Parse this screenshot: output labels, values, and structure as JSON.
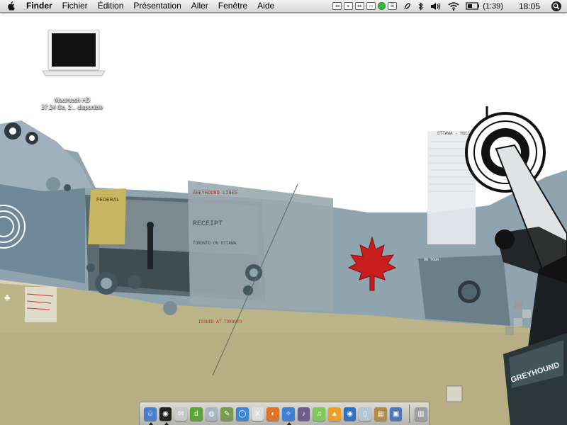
{
  "menubar": {
    "app_name": "Finder",
    "menus": [
      "Fichier",
      "Édition",
      "Présentation",
      "Aller",
      "Fenêtre",
      "Aide"
    ],
    "battery_text": "(1:39)",
    "clock": "18:05"
  },
  "desktop": {
    "hd_name": "Macintosh HD",
    "hd_info": "37,24 Go, 2... disponible"
  },
  "wallpaper": {
    "receipt_title": "RECEIPT",
    "receipt_header": "GREYHOUND LINES",
    "receipt_route": "TORONTO ON  OTTAWA",
    "timetable_title": "OTTAWA - HULL",
    "bus_brand": "GREYHOUND",
    "ticket_label": "FEDERAL",
    "station_label": "ON TOUR",
    "stamp_text": "ISSUED AT TORONTO"
  },
  "dock": {
    "items": [
      {
        "name": "finder-dock-icon",
        "color": "#4a7fd0",
        "glyph": "☺"
      },
      {
        "name": "dashboard-dock-icon",
        "color": "#222222",
        "glyph": "◉"
      },
      {
        "name": "mail-dock-icon",
        "color": "#c9c9c9",
        "glyph": "✉"
      },
      {
        "name": "dreamweaver-dock-icon",
        "color": "#5aa832",
        "glyph": "d"
      },
      {
        "name": "app-dock-icon-1",
        "color": "#a8b4c2",
        "glyph": "◍"
      },
      {
        "name": "pencil-app-dock-icon",
        "color": "#7a9a54",
        "glyph": "✎"
      },
      {
        "name": "ichat-dock-icon",
        "color": "#3a86d8",
        "glyph": "◯"
      },
      {
        "name": "x11-dock-icon",
        "color": "#dddddd",
        "glyph": "X"
      },
      {
        "name": "firefox-dock-icon",
        "color": "#e0731f",
        "glyph": "◐"
      },
      {
        "name": "safari-dock-icon",
        "color": "#3d7fd4",
        "glyph": "✧"
      },
      {
        "name": "garageband-dock-icon",
        "color": "#6e5c8a",
        "glyph": "♪"
      },
      {
        "name": "itunes-dock-icon",
        "color": "#7fc95a",
        "glyph": "♫"
      },
      {
        "name": "vlc-dock-icon",
        "color": "#f0a020",
        "glyph": "▲"
      },
      {
        "name": "app-dock-icon-2",
        "color": "#2a6fc8",
        "glyph": "◉"
      },
      {
        "name": "preview-dock-icon",
        "color": "#b5c6d9",
        "glyph": "▯"
      },
      {
        "name": "book-dock-icon",
        "color": "#b58a48",
        "glyph": "▤"
      },
      {
        "name": "app-dock-icon-3",
        "color": "#4978b8",
        "glyph": "▣"
      },
      {
        "name": "trash-dock-icon",
        "color": "#9aa0a6",
        "glyph": "▥"
      }
    ]
  },
  "colors": {
    "sky_blue": "#8fa3ad",
    "khaki": "#b4ad80",
    "sage": "#aab59a",
    "maple_red": "#c81e1e"
  }
}
